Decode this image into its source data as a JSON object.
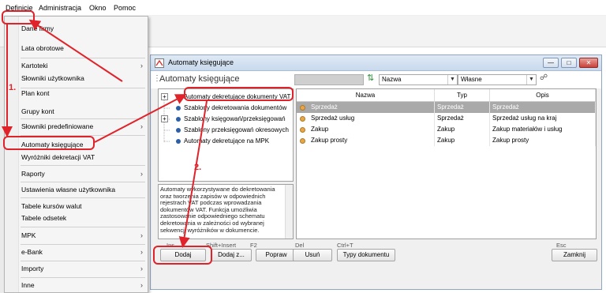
{
  "menubar": {
    "items": [
      "Definicje",
      "Administracja",
      "Okno",
      "Pomoc"
    ]
  },
  "dropdown": {
    "items": [
      {
        "label": "Dane firmy",
        "submenu": false
      },
      {
        "label": "Lata obrotowe",
        "submenu": false
      },
      {
        "label": "Kartoteki",
        "submenu": true
      },
      {
        "label": "Słowniki użytkownika",
        "submenu": false
      },
      {
        "label": "Plan kont",
        "submenu": false
      },
      {
        "label": "Grupy kont",
        "submenu": false
      },
      {
        "label": "Słowniki predefiniowane",
        "submenu": true
      },
      {
        "label": "Automaty księgujące",
        "submenu": false
      },
      {
        "label": "Wyróżniki dekretacji VAT",
        "submenu": false
      },
      {
        "label": "Raporty",
        "submenu": true
      },
      {
        "label": "Ustawienia własne użytkownika",
        "submenu": false
      },
      {
        "label": "Tabele kursów walut",
        "submenu": false
      },
      {
        "label": "Tabele odsetek",
        "submenu": false
      },
      {
        "label": "MPK",
        "submenu": true
      },
      {
        "label": "e-Bank",
        "submenu": true
      },
      {
        "label": "Importy",
        "submenu": true
      },
      {
        "label": "Inne",
        "submenu": true
      }
    ]
  },
  "window": {
    "titlebar": "Automaty księgujące",
    "title": "Automaty księgujące",
    "sort_field": "Nazwa",
    "filter_value": "Własne"
  },
  "tree": {
    "nodes": [
      {
        "label": "Automaty dekretujące dokumenty VAT",
        "expandable": true
      },
      {
        "label": "Szablony dekretowania dokumentów",
        "expandable": false
      },
      {
        "label": "Szablony księgowań/przeksięgowań",
        "expandable": true
      },
      {
        "label": "Szablony przeksięgowań okresowych",
        "expandable": false
      },
      {
        "label": "Automaty dekretujące na MPK",
        "expandable": false
      }
    ]
  },
  "description": "Automaty wykorzystywane do dekretowania oraz tworzenia zapisów w odpowiednich rejestrach VAT podczas wprowadzania dokumentów VAT. Funkcja umożliwia zastosowanie odpowiedniego schematu dekretowania w zależności od wybranej sekwencji wyróżników w dokumencie.",
  "grid": {
    "columns": [
      "Nazwa",
      "Typ",
      "Opis"
    ],
    "rows": [
      {
        "nazwa": "Sprzedaż",
        "typ": "Sprzedaż",
        "opis": "Sprzedaż",
        "selected": true
      },
      {
        "nazwa": "Sprzedaż usług",
        "typ": "Sprzedaż",
        "opis": "Sprzedaż usług na kraj",
        "selected": false
      },
      {
        "nazwa": "Zakup",
        "typ": "Zakup",
        "opis": "Zakup materiałów i usług",
        "selected": false
      },
      {
        "nazwa": "Zakup prosty",
        "typ": "Zakup",
        "opis": "Zakup prosty",
        "selected": false
      }
    ]
  },
  "buttons": {
    "add": "Dodaj",
    "add_shortcut": "Ins",
    "add_copy": "Dodaj z...",
    "add_copy_shortcut": "Shift+Insert",
    "edit": "Popraw",
    "edit_shortcut": "F2",
    "delete": "Usuń",
    "delete_shortcut": "Del",
    "doc_types": "Typy dokumentu",
    "doc_types_shortcut": "Ctrl+T",
    "close": "Zamknij",
    "close_shortcut": "Esc"
  },
  "annotations": {
    "step1": "1.",
    "step2": "2."
  },
  "colors": {
    "annotation_red": "#e0232a",
    "selected_row": "#a9a9a9",
    "tree_dot": "#2d5fa8",
    "grid_dot": "#e6a74a"
  }
}
